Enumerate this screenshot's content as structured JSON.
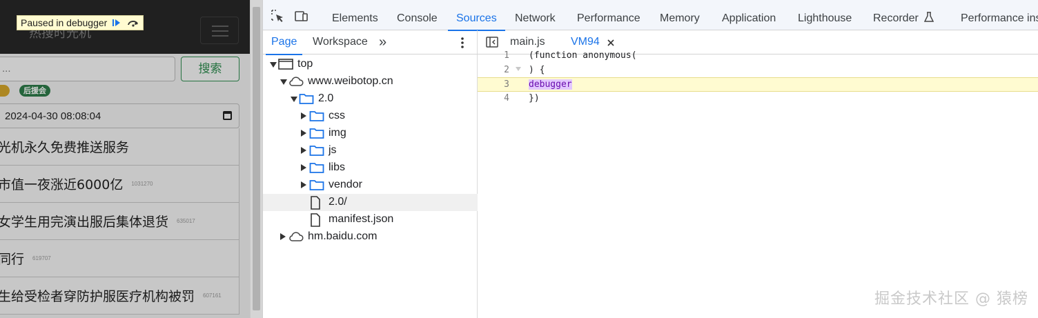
{
  "page": {
    "brand": "热搜时光机",
    "search_placeholder": "...",
    "search_button": "搜索",
    "tag_green": "后援会",
    "date_value": "2024-04-30 08:08:04",
    "items": [
      {
        "text": "光机永久免费推送服务",
        "count": ""
      },
      {
        "text": "市值一夜涨近6000亿",
        "count": "1031270"
      },
      {
        "text": "女学生用完演出服后集体退货",
        "count": "635017"
      },
      {
        "text": "同行",
        "count": "619707"
      },
      {
        "text": "生给受检者穿防护服医疗机构被罚",
        "count": "607161"
      }
    ]
  },
  "paused_banner": {
    "label": "Paused in debugger",
    "resume_icon": "resume-icon",
    "step_icon": "step-over-icon"
  },
  "devtools": {
    "tabs": [
      "Elements",
      "Console",
      "Sources",
      "Network",
      "Performance",
      "Memory",
      "Application",
      "Lighthouse",
      "Recorder",
      "Performance ins"
    ],
    "active_tab": "Sources",
    "nav_tabs": [
      "Page",
      "Workspace"
    ],
    "active_nav_tab": "Page",
    "more_tabs": "»",
    "tree": [
      {
        "label": "top",
        "icon": "frame-icon",
        "depth": 0,
        "arrow": "down"
      },
      {
        "label": "www.weibotop.cn",
        "icon": "cloud-icon",
        "depth": 1,
        "arrow": "down"
      },
      {
        "label": "2.0",
        "icon": "folder-icon",
        "depth": 2,
        "arrow": "down"
      },
      {
        "label": "css",
        "icon": "folder-icon",
        "depth": 3,
        "arrow": "right"
      },
      {
        "label": "img",
        "icon": "folder-icon",
        "depth": 3,
        "arrow": "right"
      },
      {
        "label": "js",
        "icon": "folder-icon",
        "depth": 3,
        "arrow": "right"
      },
      {
        "label": "libs",
        "icon": "folder-icon",
        "depth": 3,
        "arrow": "right"
      },
      {
        "label": "vendor",
        "icon": "folder-icon",
        "depth": 3,
        "arrow": "right"
      },
      {
        "label": "2.0/",
        "icon": "file-icon",
        "depth": 3,
        "arrow": "",
        "selected": true
      },
      {
        "label": "manifest.json",
        "icon": "file-icon",
        "depth": 3,
        "arrow": ""
      },
      {
        "label": "hm.baidu.com",
        "icon": "cloud-icon",
        "depth": 1,
        "arrow": "right"
      }
    ],
    "editor_tabs": [
      {
        "label": "main.js",
        "active": false
      },
      {
        "label": "VM94",
        "active": true
      }
    ],
    "code_lines": [
      {
        "num": "1",
        "text": "(function anonymous("
      },
      {
        "num": "2",
        "text": ") {"
      },
      {
        "num": "3",
        "text": "debugger"
      },
      {
        "num": "4",
        "text": "})"
      }
    ]
  },
  "watermark": "掘金技术社区 @ 猿榜",
  "colors": {
    "accent": "#1a73e8",
    "paused_bg": "#fffbd1",
    "debugger_highlight": "#e3c8ff"
  }
}
